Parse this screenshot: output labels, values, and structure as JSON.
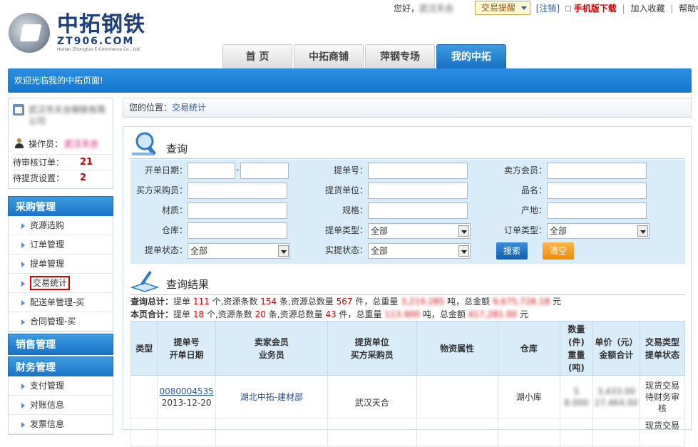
{
  "logo": {
    "name_cn": "中拓钢铁",
    "domain": "ZT906.COM",
    "company_en": "Hunan Zhongtuo E-Commerce Co., Ltd"
  },
  "top_bar": {
    "greeting": "您好，",
    "user_name": "武汉天合",
    "trade_remind": "交易提醒",
    "logout": "[注销]",
    "mobile_download": "手机版下载",
    "add_favorite": "加入收藏",
    "help": "帮助中心"
  },
  "nav": {
    "tabs": [
      "首 页",
      "中拓商铺",
      "萍钢专场",
      "我的中拓"
    ],
    "active": 3
  },
  "welcome": "欢迎光临我的中拓页面!",
  "user_panel": {
    "company": "武汉市天合钢铁有限公司",
    "operator_label": "操作员：",
    "operator_name": "武汉天合",
    "pending_orders_label": "待审核订单：",
    "pending_orders": "21",
    "pending_pickup_label": "待提货设置：",
    "pending_pickup": "2"
  },
  "menu": {
    "purchase_title": "采购管理",
    "purchase_items": [
      "资源选购",
      "订单管理",
      "提单管理",
      "交易统计",
      "配送单管理-买",
      "合同管理-买"
    ],
    "sales_title": "销售管理",
    "finance_title": "财务管理",
    "finance_items": [
      "支付管理",
      "对账信息",
      "发票信息"
    ]
  },
  "breadcrumb": {
    "prefix": "您的位置：",
    "current": "交易统计"
  },
  "query": {
    "title": "查询",
    "labels": {
      "open_date": "开单日期：",
      "bill_no": "提单号：",
      "seller": "卖方会员：",
      "buyer": "买方采购员：",
      "pickup_unit": "提货单位：",
      "product_name": "品名：",
      "material": "材质：",
      "spec": "规格：",
      "origin": "产地：",
      "warehouse": "仓库：",
      "bill_type": "提单类型：",
      "order_type": "订单类型：",
      "bill_status": "提单状态：",
      "actual_status": "实提状态："
    },
    "date_sep": "-",
    "select_all": "全部",
    "search_btn": "搜索",
    "clear_btn": "清空"
  },
  "results": {
    "title": "查询结果",
    "total_label": "查询总计",
    "total": {
      "bills": "111",
      "records": "154",
      "quantity": "567",
      "weight": "3,219.285",
      "amount": "9,675,728.18"
    },
    "page_label": "本页合计",
    "page": {
      "bills": "18",
      "records": "20",
      "quantity": "43",
      "weight": "113.900",
      "amount": "417,281.00"
    },
    "text": {
      "colon": "：",
      "bill_prefix": "提单",
      "bill_suffix": "个,资源条数",
      "records_suffix": "条,资源总数量",
      "qty_suffix": "件，总重量",
      "weight_suffix": "吨，总金额",
      "amount_suffix": "元"
    },
    "columns": [
      "类型",
      "提单号\n开单日期",
      "卖家会员\n业务员",
      "提货单位\n买方采购员",
      "物资属性",
      "仓库",
      "数量\n(件)\n重量\n(吨)",
      "单价（元）\n金额合计",
      "交易类型\n提单状态"
    ],
    "rows": [
      {
        "type": "",
        "bill_no": "0080004535",
        "date": "2013-12-20",
        "seller": "湖北中拓-建材部",
        "buyer": "武汉天合",
        "attr": "",
        "warehouse": "湖小库",
        "qty": "5",
        "weight": "8.000",
        "price": "3,433.00",
        "total": "27,464.00",
        "trade_type": "现货交易",
        "status": "待财务审核"
      },
      {
        "type": "",
        "bill_no": "",
        "date": "",
        "seller": "",
        "buyer": "",
        "attr": "",
        "warehouse": "",
        "qty": "",
        "weight": "",
        "price": "",
        "total": "",
        "trade_type": "现货交易",
        "status": ""
      }
    ]
  }
}
